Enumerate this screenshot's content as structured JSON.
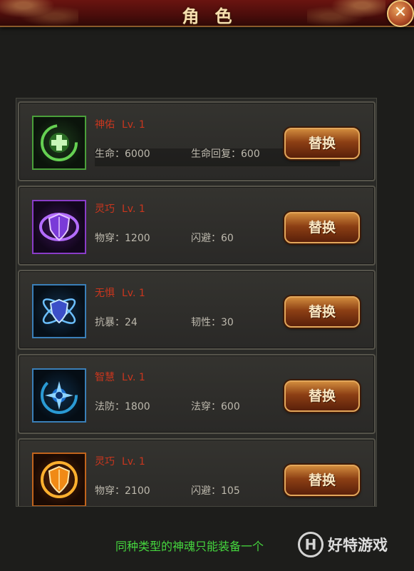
{
  "header": {
    "title": "角色",
    "close_icon": "close-icon",
    "colors": {
      "bar": "#4a0d0b",
      "title": "#f7e0b0"
    }
  },
  "soul_list": {
    "items": [
      {
        "name": "神佑",
        "level": "Lv. 1",
        "stat_a": "生命：6000",
        "stat_b": "生命回复：600",
        "button_label": "替换",
        "icon": "green-cross-orb-icon",
        "icon_color": "#4aa03a"
      },
      {
        "name": "灵巧",
        "level": "Lv. 1",
        "stat_a": "物穿：1200",
        "stat_b": "闪避：60",
        "button_label": "替换",
        "icon": "purple-shield-orb-icon",
        "icon_color": "#8a3cc8"
      },
      {
        "name": "无惧",
        "level": "Lv. 1",
        "stat_a": "抗暴：24",
        "stat_b": "韧性：30",
        "button_label": "替换",
        "icon": "blue-atom-shield-icon",
        "icon_color": "#3a7fb8"
      },
      {
        "name": "智慧",
        "level": "Lv. 1",
        "stat_a": "法防：1800",
        "stat_b": "法穿：600",
        "button_label": "替换",
        "icon": "blue-star-orb-icon",
        "icon_color": "#3a7fb8"
      },
      {
        "name": "灵巧",
        "level": "Lv. 1",
        "stat_a": "物穿：2100",
        "stat_b": "闪避：105",
        "button_label": "替换",
        "icon": "orange-shield-orb-icon",
        "icon_color": "#c2641c"
      }
    ]
  },
  "footer": {
    "note": "同种类型的神魂只能装备一个",
    "note_color": "#45d63e"
  },
  "watermark": {
    "logo_letter": "H",
    "text": "好特游戏"
  }
}
